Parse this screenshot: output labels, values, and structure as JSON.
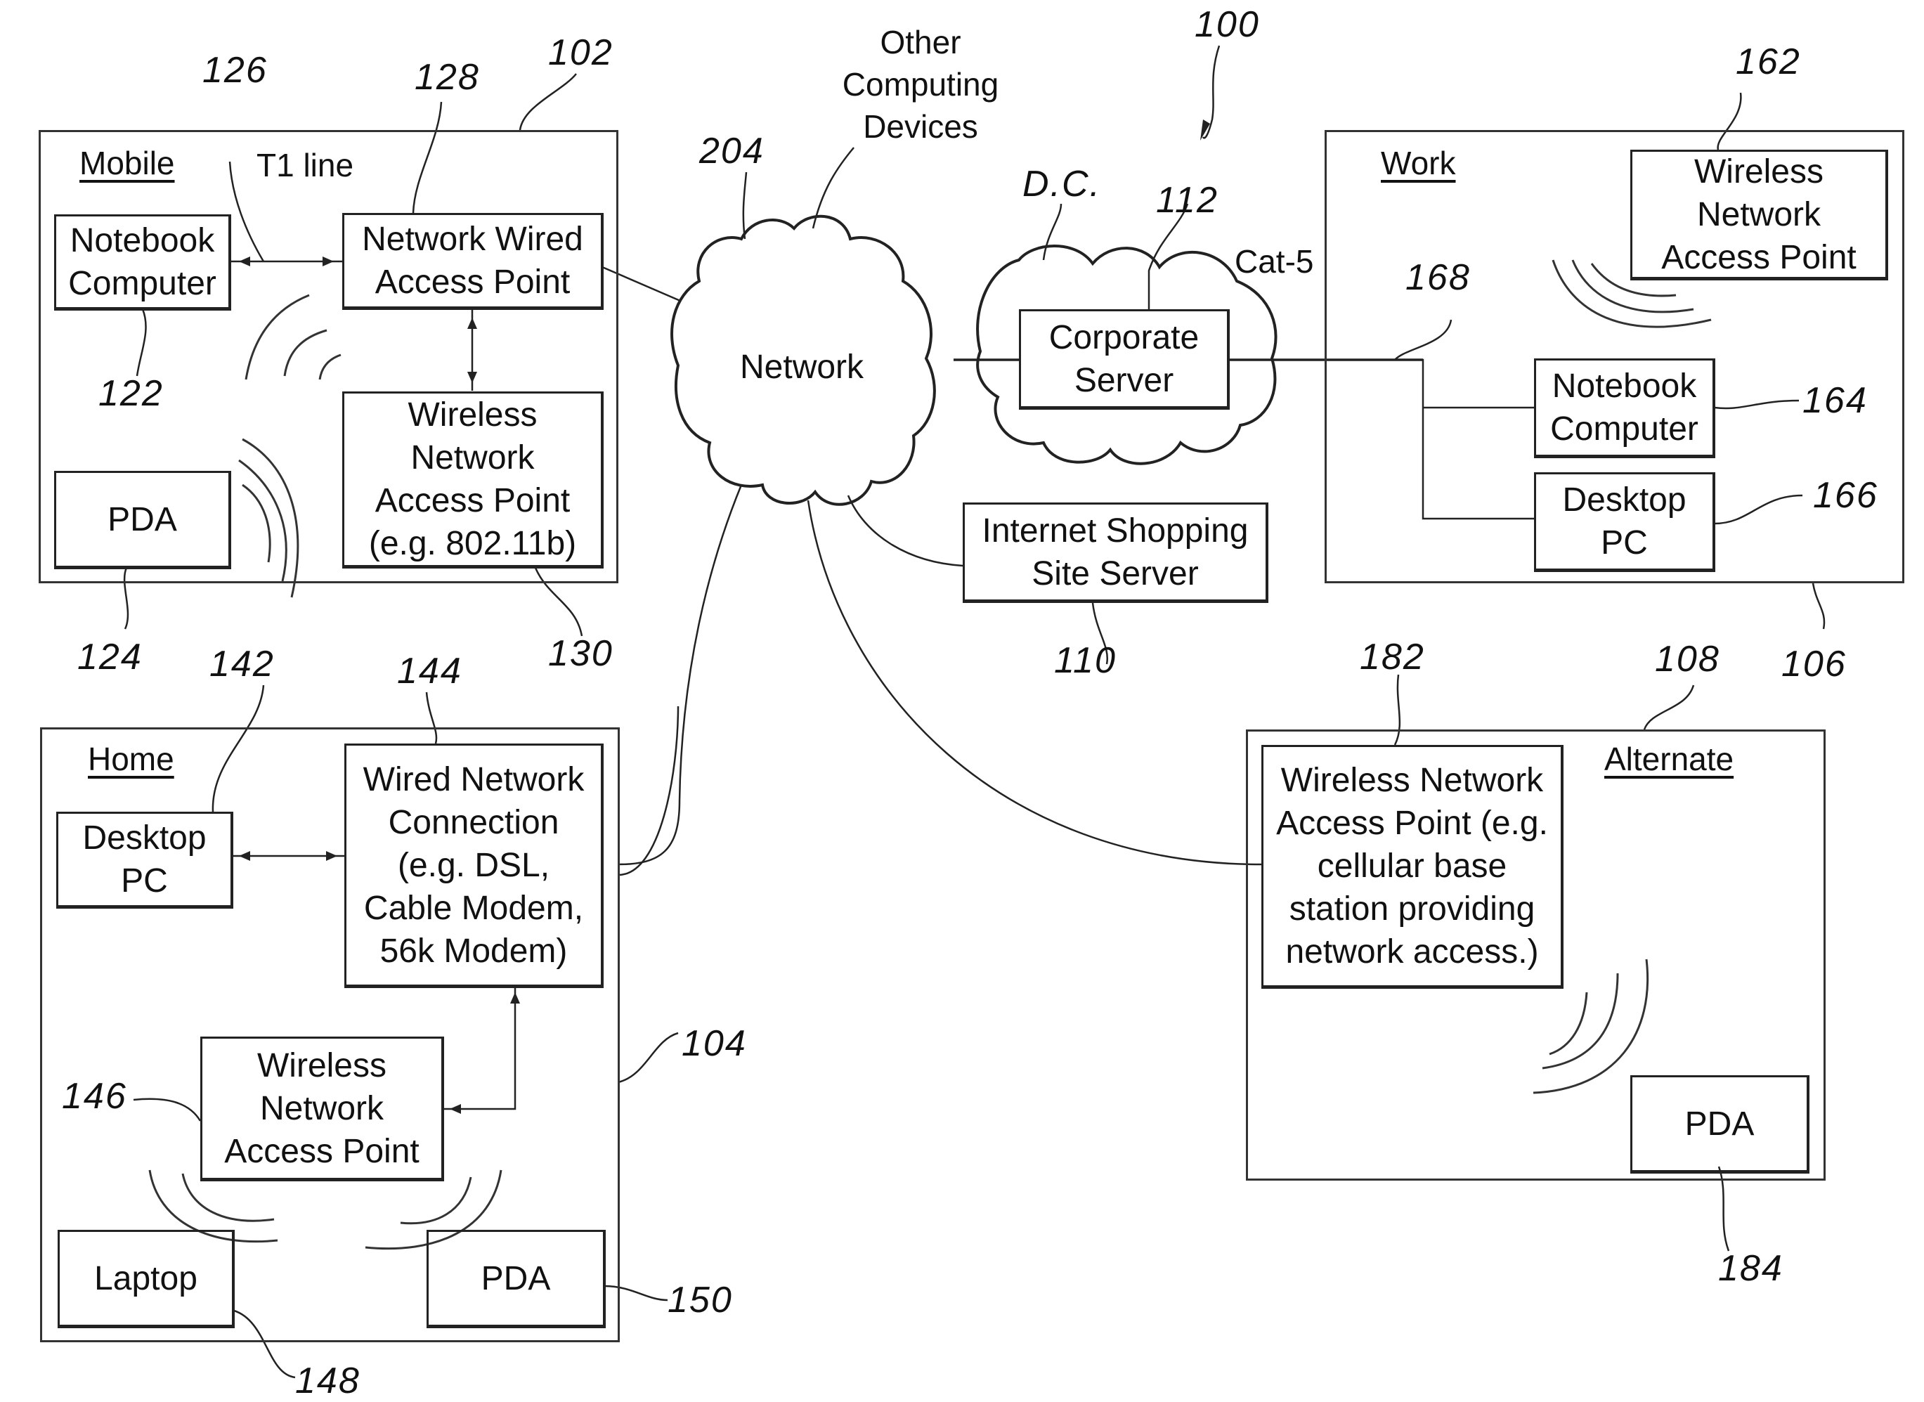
{
  "figure_ref": "100",
  "network": {
    "label": "Network",
    "ref": "204"
  },
  "other_devices": {
    "lines": [
      "Other",
      "Computing",
      "Devices"
    ]
  },
  "dc": {
    "label": "D.C.",
    "ref": "112",
    "cable": "Cat-5",
    "server_lines": [
      "Corporate",
      "Server"
    ]
  },
  "shopping": {
    "lines": [
      "Internet Shopping",
      "Site Server"
    ],
    "ref": "110"
  },
  "mobile": {
    "title": "Mobile",
    "ref": "102",
    "link_label": "T1 line",
    "link_ref": "126",
    "notebook": {
      "lines": [
        "Notebook",
        "Computer"
      ],
      "ref": "122"
    },
    "wired_ap": {
      "lines": [
        "Network Wired",
        "Access Point"
      ],
      "ref": "128"
    },
    "wireless_ap": {
      "lines": [
        "Wireless",
        "Network",
        "Access Point",
        "(e.g. 802.11b)"
      ],
      "ref": "130"
    },
    "pda": {
      "label": "PDA",
      "ref": "124"
    }
  },
  "work": {
    "title": "Work",
    "ref": "106",
    "bus_ref": "168",
    "wireless_ap": {
      "lines": [
        "Wireless",
        "Network",
        "Access Point"
      ],
      "ref": "162"
    },
    "notebook": {
      "lines": [
        "Notebook",
        "Computer"
      ],
      "ref": "164"
    },
    "desktop": {
      "lines": [
        "Desktop",
        "PC"
      ],
      "ref": "166"
    }
  },
  "home": {
    "title": "Home",
    "ref": "104",
    "desktop": {
      "lines": [
        "Desktop",
        "PC"
      ],
      "ref": "142"
    },
    "wired_conn": {
      "lines": [
        "Wired Network",
        "Connection",
        "(e.g. DSL,",
        "Cable Modem,",
        "56k Modem)"
      ],
      "ref": "144"
    },
    "wireless_ap": {
      "lines": [
        "Wireless",
        "Network",
        "Access Point"
      ],
      "ref": "146"
    },
    "laptop": {
      "label": "Laptop",
      "ref": "148"
    },
    "pda": {
      "label": "PDA",
      "ref": "150"
    }
  },
  "alternate": {
    "title": "Alternate",
    "ref": "108",
    "wireless_ap": {
      "lines": [
        "Wireless Network",
        "Access Point (e.g.",
        "cellular base",
        "station providing",
        "network access.)"
      ],
      "ref": "182"
    },
    "pda": {
      "label": "PDA",
      "ref": "184"
    }
  }
}
